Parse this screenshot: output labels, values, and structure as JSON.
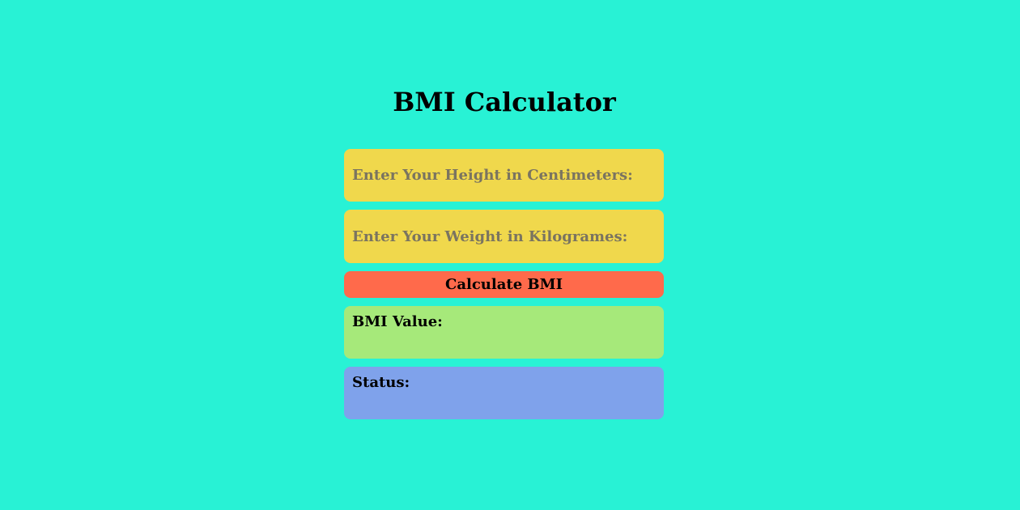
{
  "app": {
    "title": "BMI Calculator"
  },
  "form": {
    "height_input": {
      "placeholder": "Enter Your Height in Centimeters:",
      "value": ""
    },
    "weight_input": {
      "placeholder": "Enter Your Weight in Kilogrames:",
      "value": ""
    },
    "calculate_label": "Calculate BMI"
  },
  "results": {
    "bmi_label": "BMI Value:",
    "status_label": "Status:"
  },
  "colors": {
    "background": "#28f2d5",
    "input_background": "#f0d84c",
    "button_background": "#ff6a4b",
    "bmi_box_background": "#a6e97a",
    "status_box_background": "#7fa2eb",
    "placeholder_text": "#7a7460"
  }
}
